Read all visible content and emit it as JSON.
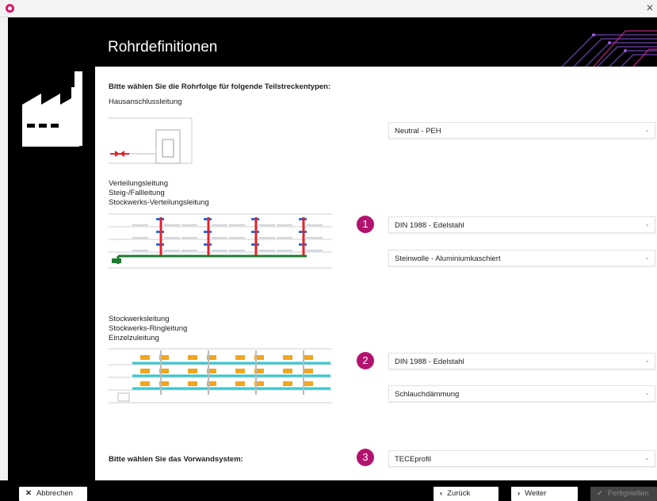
{
  "header": {
    "title": "Rohrdefinitionen"
  },
  "main": {
    "intro": "Bitte wählen Sie die Rohrfolge für folgende Teilstreckentypen:",
    "section1": {
      "label": "Hausanschlussleitung",
      "select": "Neutral - PEH"
    },
    "section2": {
      "label_lines": [
        "Verteilungsleitung",
        "Steig-/Fallleitung",
        "Stockwerks-Verteilungsleitung"
      ],
      "badge": "1",
      "select_pipe": "DIN 1988 - Edelstahl",
      "select_insulation": "Steinwolle - Aluminiumkaschiert"
    },
    "section3": {
      "label_lines": [
        "Stockwerksleitung",
        "Stockwerks-Ringleitung",
        "Einzelzuleitung"
      ],
      "badge": "2",
      "select_pipe": "DIN 1988 - Edelstahl",
      "select_insulation": "Schlauchdämmung"
    },
    "section4": {
      "label": "Bitte wählen Sie das Vorwandsystem:",
      "badge": "3",
      "select": "TECEprofil"
    }
  },
  "footer": {
    "cancel": "Abbrechen",
    "back": "Zurück",
    "next": "Weiter",
    "finish": "Fertigstellen"
  },
  "colors": {
    "accent": "#b3126e",
    "riser": "#e8202a",
    "distribution": "#1e7a2e",
    "branch": "#37c8d0",
    "fixture": "#f2a51f"
  }
}
